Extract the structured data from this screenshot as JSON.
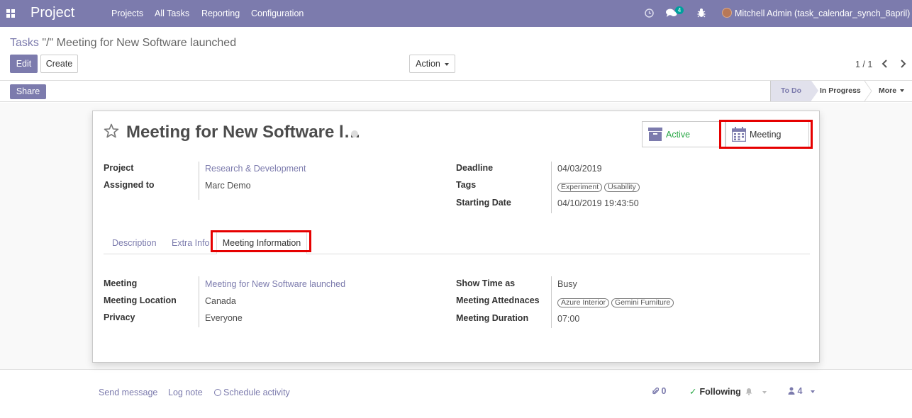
{
  "navbar": {
    "app_name": "Project",
    "menu": [
      "Projects",
      "All Tasks",
      "Reporting",
      "Configuration"
    ],
    "chat_count": "4",
    "user": "Mitchell Admin (task_calendar_synch_8april)",
    "color": "#7c7bad"
  },
  "breadcrumb": {
    "parent": "Tasks",
    "separator": "\"/\"",
    "current": "Meeting for New Software launched"
  },
  "buttons": {
    "edit": "Edit",
    "create": "Create",
    "action": "Action",
    "share": "Share"
  },
  "pager": {
    "value": "1 / 1"
  },
  "stages": {
    "todo": "To Do",
    "in_progress": "In Progress",
    "more": "More"
  },
  "form": {
    "title": "Meeting for New Software l…",
    "smart_buttons": {
      "active": "Active",
      "meeting": "Meeting"
    },
    "left_fields": [
      {
        "label": "Project",
        "value": "Research & Development"
      },
      {
        "label": "Assigned to",
        "value": "Marc Demo"
      }
    ],
    "right_fields": {
      "deadline": {
        "label": "Deadline",
        "value": "04/03/2019"
      },
      "tags": {
        "label": "Tags",
        "values": [
          "Experiment",
          "Usability"
        ]
      },
      "starting_date": {
        "label": "Starting Date",
        "value": "04/10/2019 19:43:50"
      }
    },
    "tabs": {
      "description": "Description",
      "extra_info": "Extra Info",
      "meeting_information": "Meeting Information"
    },
    "meeting_left": [
      {
        "label": "Meeting",
        "value": "Meeting for New Software launched"
      },
      {
        "label": "Meeting Location",
        "value": "Canada"
      },
      {
        "label": "Privacy",
        "value": "Everyone"
      }
    ],
    "meeting_right": {
      "show_time": {
        "label": "Show Time as",
        "value": "Busy"
      },
      "attendees": {
        "label": "Meeting Attednaces",
        "values": [
          "Azure Interior",
          "Gemini Furniture"
        ]
      },
      "duration": {
        "label": "Meeting Duration",
        "value": "07:00"
      }
    }
  },
  "chatter": {
    "send_message": "Send message",
    "log_note": "Log note",
    "schedule_activity": "Schedule activity",
    "attachments": "0",
    "following": "Following",
    "followers": "4"
  }
}
